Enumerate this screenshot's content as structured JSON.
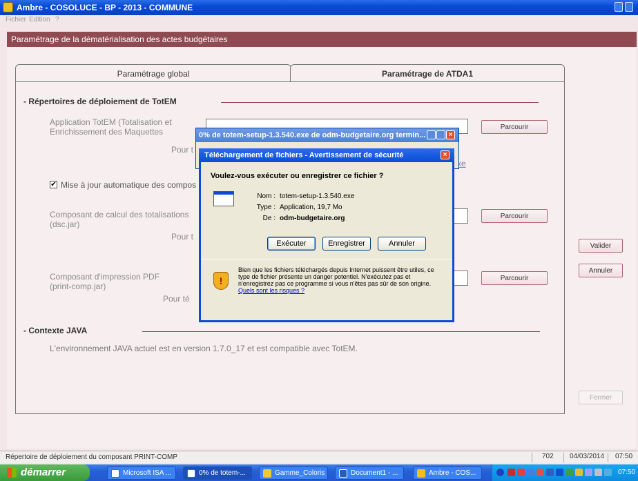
{
  "window": {
    "title": "Ambre - COSOLUCE - BP - 2013 - COMMUNE"
  },
  "menu": [
    "Fichier",
    "Edition",
    "?"
  ],
  "page": {
    "header": "Paramétrage de la dématérialisation des actes budgétaires"
  },
  "tabs": [
    {
      "label": "Paramétrage global",
      "active": false
    },
    {
      "label": "Paramétrage de ATDA1",
      "active": true
    }
  ],
  "sections": {
    "deploy": {
      "title": "- Répertoires de déploiement de TotEM",
      "app_label_line1": "Application TotEM (Totalisation et",
      "app_label_line2": "Enrichissement des Maquettes",
      "app_pour": "Pour t",
      "app_link_partial": "xe",
      "checkbox_label": "Mise à jour automatique des compos",
      "checkbox_checked": true,
      "calc_label_line1": "Composant de calcul des totalisations",
      "calc_label_line2": "(dsc.jar)",
      "calc_pour": "Pour t",
      "pdf_label_line1": "Composant d'impression PDF",
      "pdf_label_line2": "(print-comp.jar)",
      "pdf_pour": "Pour té",
      "browse_label": "Parcourir"
    },
    "java": {
      "title": "- Contexte JAVA",
      "text": "L'environnement JAVA actuel est en version 1.7.0_17 et est compatible avec TotEM."
    }
  },
  "side_buttons": {
    "validate": "Valider",
    "cancel": "Annuler",
    "close": "Fermer"
  },
  "download_window": {
    "title": "0% de totem-setup-1.3.540.exe de odm-budgetaire.org termin..."
  },
  "security_dialog": {
    "title": "Téléchargement de fichiers - Avertissement de sécurité",
    "question": "Voulez-vous exécuter ou enregistrer ce fichier ?",
    "name_label": "Nom :",
    "name_value": "totem-setup-1.3.540.exe",
    "type_label": "Type :",
    "type_value": "Application, 19,7 Mo",
    "from_label": "De :",
    "from_value": "odm-budgetaire.org",
    "btn_run": "Exécuter",
    "btn_save": "Enregistrer",
    "btn_cancel": "Annuler",
    "warning_line1": "Bien que les fichiers téléchargés depuis Internet puissent être utiles, ce",
    "warning_line2": "type de fichier présente un danger potentiel. N'exécutez pas et",
    "warning_line3": "n'enregistrez pas ce programme si vous n'êtes pas sûr de son origine.",
    "risk_link": "Quels sont les risques ?"
  },
  "statusbar": {
    "message": "Répertoire de déploiement du composant PRINT-COMP",
    "code": "702",
    "date": "04/03/2014",
    "time": "07:50"
  },
  "taskbar": {
    "start_label": "démarrer",
    "tasks": [
      {
        "label": "Microsoft ISA ...",
        "active": false
      },
      {
        "label": "0% de totem-...",
        "active": true
      },
      {
        "label": "Gamme_Coloris",
        "active": false
      },
      {
        "label": "Document1 - ...",
        "active": false
      },
      {
        "label": "Ambre - COS...",
        "active": false
      }
    ],
    "clock": "07:50"
  }
}
